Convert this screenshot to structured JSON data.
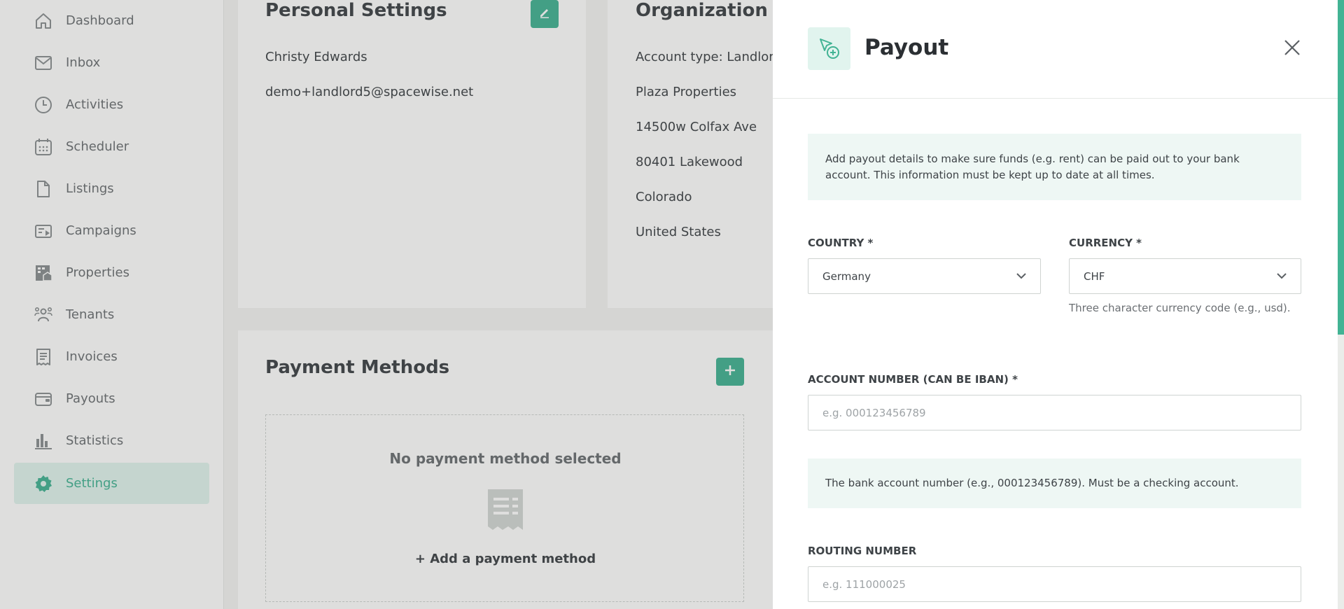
{
  "sidebar": {
    "items": [
      {
        "label": "Dashboard",
        "icon": "home-icon"
      },
      {
        "label": "Inbox",
        "icon": "mail-icon"
      },
      {
        "label": "Activities",
        "icon": "clock-icon"
      },
      {
        "label": "Scheduler",
        "icon": "calendar-icon"
      },
      {
        "label": "Listings",
        "icon": "file-icon"
      },
      {
        "label": "Campaigns",
        "icon": "campaign-icon"
      },
      {
        "label": "Properties",
        "icon": "building-icon"
      },
      {
        "label": "Tenants",
        "icon": "users-icon"
      },
      {
        "label": "Invoices",
        "icon": "receipt-icon"
      },
      {
        "label": "Payouts",
        "icon": "wallet-icon"
      },
      {
        "label": "Statistics",
        "icon": "bar-chart-icon"
      },
      {
        "label": "Settings",
        "icon": "gear-icon",
        "active": true
      }
    ]
  },
  "personal": {
    "title": "Personal Settings",
    "name": "Christy Edwards",
    "email": "demo+landlord5@spacewise.net"
  },
  "organization": {
    "title": "Organization Se",
    "lines": [
      "Account type: Landlord",
      "Plaza Properties",
      "14500w Colfax Ave",
      "80401 Lakewood",
      "Colorado",
      "United States"
    ]
  },
  "payment_methods": {
    "title": "Payment Methods",
    "empty_text": "No payment method selected",
    "add_link": "+ Add a payment method"
  },
  "drawer": {
    "title": "Payout",
    "info": "Add payout details to make sure funds (e.g. rent) can be paid out to your bank account. This information must be kept up to date at all times.",
    "country": {
      "label": "COUNTRY *",
      "value": "Germany"
    },
    "currency": {
      "label": "CURRENCY *",
      "value": "CHF",
      "help": "Three character currency code (e.g., usd)."
    },
    "account_number": {
      "label": "ACCOUNT NUMBER (CAN BE IBAN) *",
      "placeholder": "e.g. 000123456789",
      "info": "The bank account number (e.g., 000123456789). Must be a checking account."
    },
    "routing_number": {
      "label": "ROUTING NUMBER",
      "placeholder": "e.g. 111000025"
    }
  },
  "colors": {
    "accent": "#42b394",
    "accent_light": "#e1f4ee",
    "info_bg": "#eef7f4"
  }
}
